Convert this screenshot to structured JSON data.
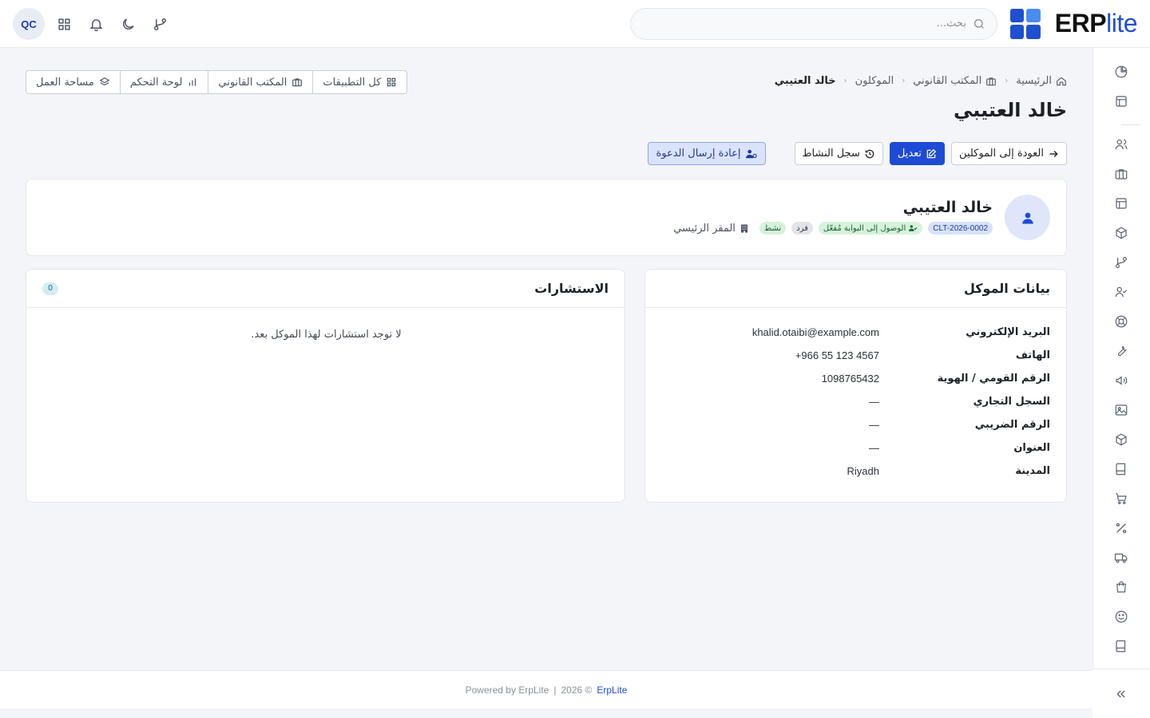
{
  "header": {
    "brand_main": "ERP",
    "brand_accent": "lite",
    "search_placeholder": "بحث...",
    "user_initials": "QC",
    "logo_colors": [
      "#4a8df0",
      "#1f4fd1",
      "#1f4fd1",
      "#1f4fd1"
    ],
    "icons": [
      "git-branch-icon",
      "moon-icon",
      "bell-icon",
      "apps-grid-icon"
    ]
  },
  "breadcrumb": [
    {
      "label": "الرئيسية",
      "icon": "home-icon"
    },
    {
      "label": "المكتب القانوني",
      "icon": "briefcase-icon"
    },
    {
      "label": "الموكلون"
    },
    {
      "label": "خالد العتيبي",
      "current": true
    }
  ],
  "quicknav": [
    {
      "label": "كل التطبيقات",
      "icon": "grid-icon"
    },
    {
      "label": "المكتب القانوني",
      "icon": "briefcase-icon"
    },
    {
      "label": "لوحة التحكم",
      "icon": "bar-chart-icon"
    },
    {
      "label": "مساحة العمل",
      "icon": "layers-icon"
    }
  ],
  "page_title": "خالد العتيبي",
  "actions": {
    "back": "العودة إلى الموكلين",
    "edit": "تعديل",
    "activity": "سجل النشاط",
    "resend": "إعادة إرسال الدعوة"
  },
  "profile": {
    "name": "خالد العتيبي",
    "code": "CLT-2026-0002",
    "portal": "الوصول إلى البوابة مُفعّل",
    "type": "فرد",
    "status": "نشط",
    "branch": "المقر الرئيسي"
  },
  "client_info": {
    "title": "بيانات الموكل",
    "rows": [
      {
        "label": "البريد الإلكتروني",
        "value": "khalid.otaibi@example.com"
      },
      {
        "label": "الهاتف",
        "value": "+966 55 123 4567"
      },
      {
        "label": "الرقم القومي / الهوية",
        "value": "1098765432"
      },
      {
        "label": "السجل التجاري",
        "value": "—"
      },
      {
        "label": "الرقم الضريبي",
        "value": "—"
      },
      {
        "label": "العنوان",
        "value": "—"
      },
      {
        "label": "المدينة",
        "value": "Riyadh"
      }
    ]
  },
  "consultations": {
    "title": "الاستشارات",
    "count": "0",
    "empty": "لا توجد استشارات لهذا الموكل بعد."
  },
  "sidebar_icons": [
    "pie-chart-icon",
    "layout-icon",
    "users-icon",
    "briefcase-icon",
    "layout-icon",
    "box-icon",
    "git-branch-icon",
    "user-check-icon",
    "lifebuoy-icon",
    "wrench-icon",
    "megaphone-icon",
    "image-icon",
    "package-icon",
    "book-icon",
    "cart-icon",
    "percent-icon",
    "truck-icon",
    "shopping-bag-icon",
    "smile-icon",
    "book-icon"
  ],
  "footer": {
    "powered": "Powered by ErpLite",
    "divider": "|",
    "year": "2026 ©",
    "brand": "ErpLite"
  }
}
